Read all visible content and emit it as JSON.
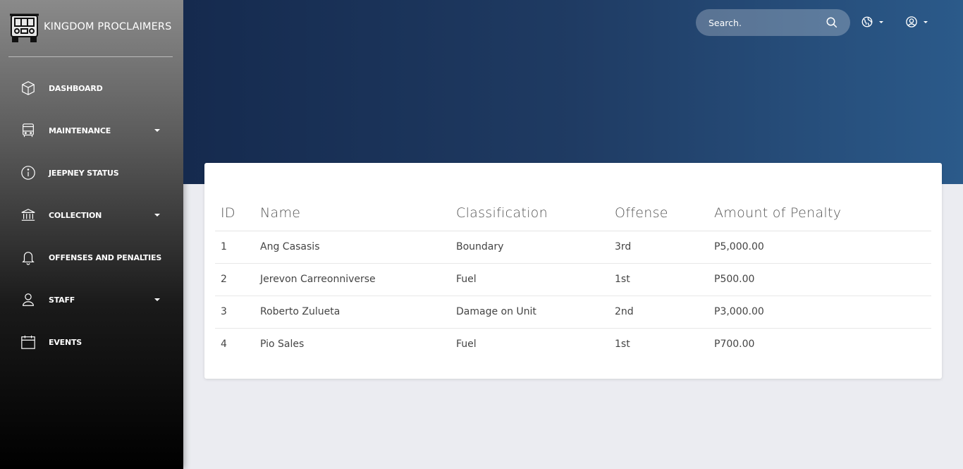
{
  "brand": {
    "name": "KINGDOM PROCLAIMERS",
    "logo_icon": "jeepney-icon"
  },
  "sidebar": {
    "items": [
      {
        "label": "DASHBOARD",
        "icon": "cube-icon",
        "dropdown": false
      },
      {
        "label": "MAINTENANCE",
        "icon": "bus-icon",
        "dropdown": true
      },
      {
        "label": "JEEPNEY STATUS",
        "icon": "info-icon",
        "dropdown": false
      },
      {
        "label": "COLLECTION",
        "icon": "bank-icon",
        "dropdown": true
      },
      {
        "label": "OFFENSES AND PENALTIES",
        "icon": "bell-icon",
        "dropdown": false
      },
      {
        "label": "STAFF",
        "icon": "user-icon",
        "dropdown": true
      },
      {
        "label": "EVENTS",
        "icon": "calendar-icon",
        "dropdown": false
      }
    ]
  },
  "header": {
    "search_placeholder": "Search.",
    "globe_icon": "globe-icon",
    "user_icon": "user-circle-icon"
  },
  "table": {
    "columns": [
      "ID",
      "Name",
      "Classification",
      "Offense",
      "Amount of Penalty"
    ],
    "rows": [
      [
        "1",
        "Ang Casasis",
        "Boundary",
        "3rd",
        "P5,000.00"
      ],
      [
        "2",
        "Jerevon Carreonniverse",
        "Fuel",
        "1st",
        "P500.00"
      ],
      [
        "3",
        "Roberto Zulueta",
        "Damage on Unit",
        "2nd",
        "P3,000.00"
      ],
      [
        "4",
        "Pio Sales",
        "Fuel",
        "1st",
        "P700.00"
      ]
    ]
  },
  "colors": {
    "header_start": "#152a4e",
    "header_end": "#2b5a8a",
    "background": "#ebecf1"
  }
}
